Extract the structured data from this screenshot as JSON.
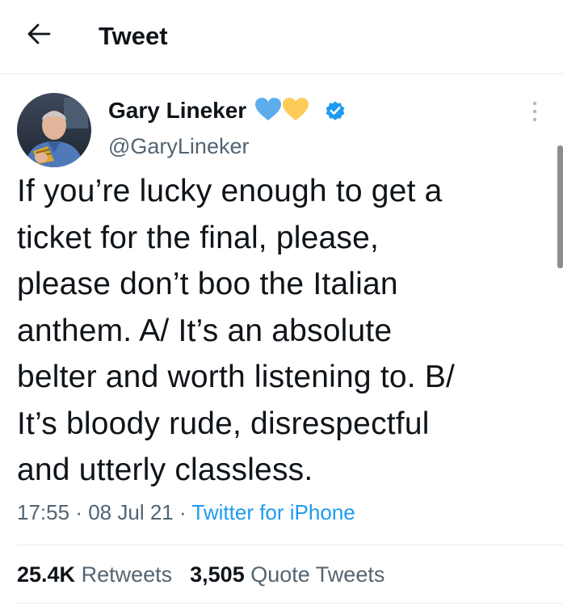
{
  "header": {
    "title": "Tweet"
  },
  "author": {
    "name": "Gary Lineker",
    "handle": "@GaryLineker",
    "name_emoji": [
      "blue-heart",
      "yellow-heart"
    ],
    "verified": true
  },
  "tweet": {
    "text": "If you’re lucky enough to get a\nticket for the final, please,\nplease don’t boo the Italian\nanthem. A/ It’s an absolute\nbelter and worth listening to. B/\nIt’s bloody rude, disrespectful\nand utterly classless.",
    "time": "17:55",
    "date": "08 Jul 21",
    "separator": "·",
    "source": "Twitter for iPhone"
  },
  "stats": {
    "retweets_count": "25.4K",
    "retweets_label": "Retweets",
    "quotes_count": "3,505",
    "quotes_label": "Quote Tweets"
  },
  "colors": {
    "accent": "#1d9bf0",
    "secondary_text": "#536471",
    "primary_text": "#0f1419",
    "divider": "#e6ecf0",
    "heart_blue": "#5dadec",
    "heart_yellow": "#fdcb58"
  }
}
